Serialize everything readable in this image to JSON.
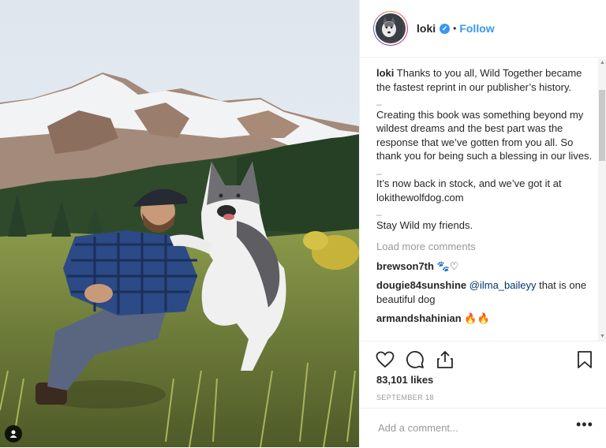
{
  "post": {
    "username": "loki",
    "follow_label": "Follow",
    "dot": "•",
    "verified_mark": "✓"
  },
  "caption": {
    "username": "loki",
    "para1": "Thanks to you all, Wild Together became the fastest reprint in our publisher’s history.",
    "para2": "Creating this book was something beyond my wildest dreams and the best part was the response that we’ve gotten from you all. So thank you for being such a blessing in our lives.",
    "para3": "It’s now back in stock, and we’ve got it at lokithewolfdog.com",
    "para4": "Stay Wild my friends.",
    "separator": "_"
  },
  "load_more": "Load more comments",
  "comments": [
    {
      "user": "brewson7th",
      "text": "",
      "emoji": "🐾♡"
    },
    {
      "user": "dougie84sunshine",
      "mention": "@ilma_baileyy",
      "text": " that is one beautiful dog"
    },
    {
      "user": "armandshahinian",
      "text": "",
      "emoji": "🔥🔥"
    }
  ],
  "likes": "83,101 likes",
  "date": "SEPTEMBER 18",
  "add_comment_placeholder": "Add a comment...",
  "more_label": "•••",
  "colors": {
    "accent": "#3897f0",
    "muted": "#999999",
    "text": "#262626"
  },
  "icons": [
    "heart-icon",
    "comment-icon",
    "share-icon",
    "bookmark-icon",
    "user-tag-icon"
  ]
}
